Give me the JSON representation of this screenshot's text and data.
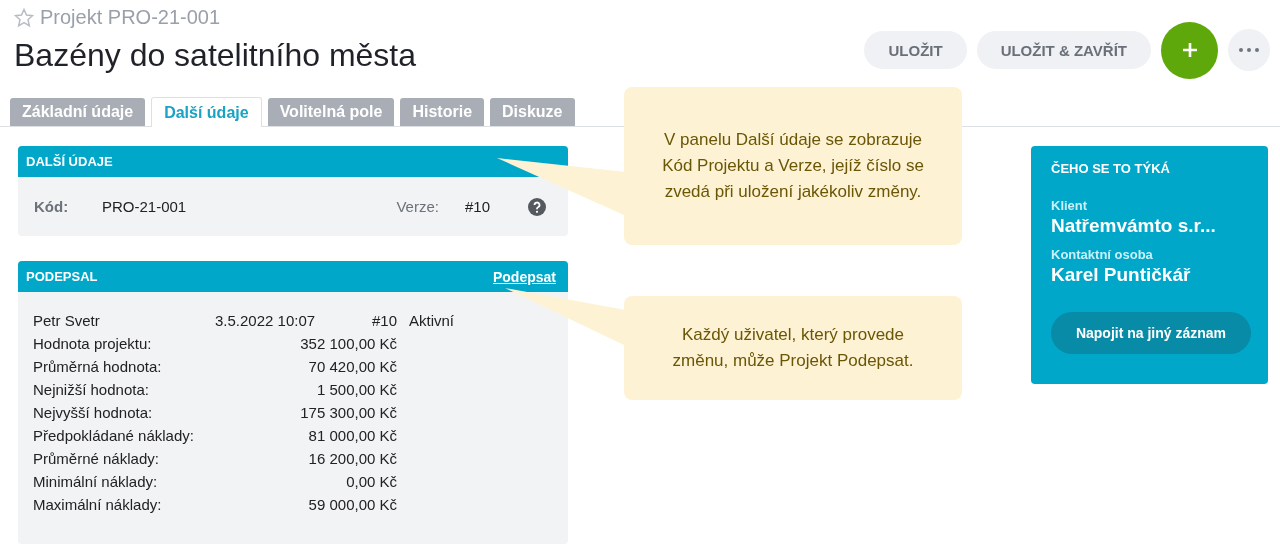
{
  "header": {
    "favorite": false,
    "subtitle": "Projekt PRO-21-001",
    "title": "Bazény do satelitního města"
  },
  "actions": [
    {
      "kind": "text",
      "label": "ULOŽIT"
    },
    {
      "kind": "text",
      "label": "ULOŽIT & ZAVŘÍT"
    },
    {
      "kind": "add"
    },
    {
      "kind": "more"
    }
  ],
  "tabs": [
    {
      "label": "Základní údaje",
      "selected": false
    },
    {
      "label": "Další údaje",
      "selected": true
    },
    {
      "label": "Volitelná pole",
      "selected": false
    },
    {
      "label": "Historie",
      "selected": false
    },
    {
      "label": "Diskuze",
      "selected": false
    }
  ],
  "details_panel": {
    "title": "DALŠÍ ÚDAJE",
    "code_label": "Kód:",
    "code": "PRO-21-001",
    "version_label": "Verze:",
    "version": "#10"
  },
  "signed_panel": {
    "title": "PODEPSAL",
    "action": "Podepsat",
    "signer": {
      "name": "Petr Svetr",
      "date": "3.5.2022 10:07",
      "version": "#10",
      "status": "Aktivní"
    },
    "rows": [
      {
        "label": "Hodnota projektu:",
        "value": "352 100,00 Kč"
      },
      {
        "label": "Průměrná hodnota:",
        "value": "70 420,00 Kč"
      },
      {
        "label": "Nejnižší hodnota:",
        "value": "1 500,00 Kč"
      },
      {
        "label": "Nejvyšší hodnota:",
        "value": "175 300,00 Kč"
      },
      {
        "label": "Předpokládané náklady:",
        "value": "81 000,00 Kč"
      },
      {
        "label": "Průměrné náklady:",
        "value": "16 200,00 Kč"
      },
      {
        "label": "Minimální náklady:",
        "value": "0,00 Kč"
      },
      {
        "label": "Maximální náklady:",
        "value": "59 000,00 Kč"
      }
    ]
  },
  "callouts": [
    "V panelu Další údaje se zobrazuje Kód Projektu a Verze, jejíž číslo se zvedá při uložení jakékoliv změny.",
    "Každý uživatel, který provede změnu, může Projekt Podepsat."
  ],
  "related_card": {
    "title": "ČEHO SE TO TÝKÁ",
    "client_label": "Klient",
    "client": "Natřemvámto s.r...",
    "contact_label": "Kontaktní osoba",
    "contact": "Karel Puntičkář",
    "button": "Napojit na jiný záznam"
  }
}
